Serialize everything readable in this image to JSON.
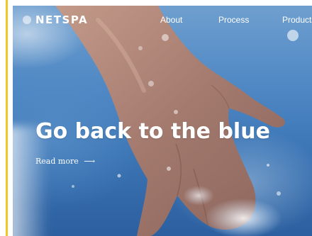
{
  "nav": {
    "logo": "NETSPA",
    "links": [
      "About",
      "Process",
      "Products"
    ]
  },
  "hero": {
    "headline": "Go back to the blue",
    "cta_label": "Read more",
    "cta_arrow": "⟶"
  },
  "colors": {
    "accent": "#f3c623",
    "water": "#4f88c4",
    "text": "#ffffff"
  }
}
